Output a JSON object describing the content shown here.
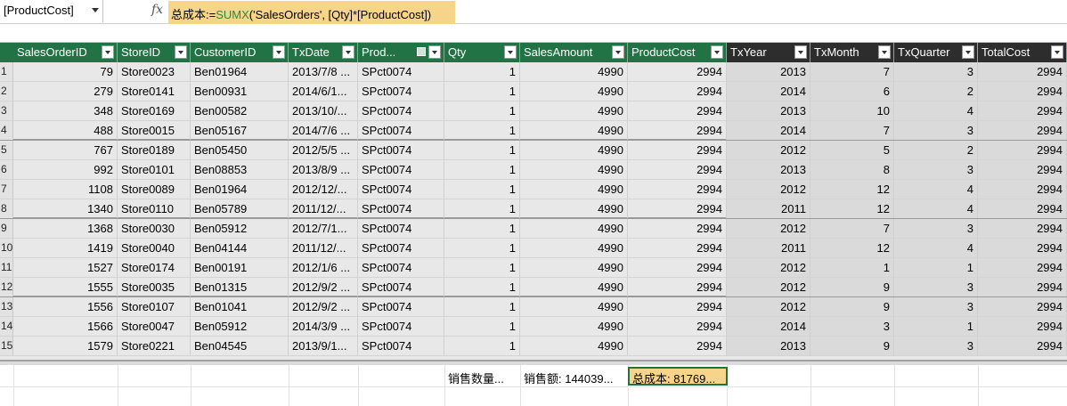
{
  "formula_bar": {
    "name_box": "[ProductCost]",
    "fx": "fx",
    "formula_prefix": "总成本:=",
    "formula_fn": "SUMX",
    "formula_rest": "('SalesOrders', [Qty]*[ProductCost])"
  },
  "columns": [
    "SalesOrderID",
    "StoreID",
    "CustomerID",
    "TxDate",
    "Prod...",
    "Qty",
    "SalesAmount",
    "ProductCost",
    "TxYear",
    "TxMonth",
    "TxQuarter",
    "TotalCost"
  ],
  "rows": [
    {
      "n": "1",
      "c": [
        "79",
        "Store0023",
        "Ben01964",
        "2013/7/8 ...",
        "SPct0074",
        "1",
        "4990",
        "2994",
        "2013",
        "7",
        "3",
        "2994"
      ]
    },
    {
      "n": "2",
      "c": [
        "279",
        "Store0141",
        "Ben00931",
        "2014/6/1...",
        "SPct0074",
        "1",
        "4990",
        "2994",
        "2014",
        "6",
        "2",
        "2994"
      ]
    },
    {
      "n": "3",
      "c": [
        "348",
        "Store0169",
        "Ben00582",
        "2013/10/...",
        "SPct0074",
        "1",
        "4990",
        "2994",
        "2013",
        "10",
        "4",
        "2994"
      ]
    },
    {
      "n": "4",
      "c": [
        "488",
        "Store0015",
        "Ben05167",
        "2014/7/6 ...",
        "SPct0074",
        "1",
        "4990",
        "2994",
        "2014",
        "7",
        "3",
        "2994"
      ]
    },
    {
      "n": "5",
      "c": [
        "767",
        "Store0189",
        "Ben05450",
        "2012/5/5 ...",
        "SPct0074",
        "1",
        "4990",
        "2994",
        "2012",
        "5",
        "2",
        "2994"
      ]
    },
    {
      "n": "6",
      "c": [
        "992",
        "Store0101",
        "Ben08853",
        "2013/8/9 ...",
        "SPct0074",
        "1",
        "4990",
        "2994",
        "2013",
        "8",
        "3",
        "2994"
      ]
    },
    {
      "n": "7",
      "c": [
        "1108",
        "Store0089",
        "Ben01964",
        "2012/12/...",
        "SPct0074",
        "1",
        "4990",
        "2994",
        "2012",
        "12",
        "4",
        "2994"
      ]
    },
    {
      "n": "8",
      "c": [
        "1340",
        "Store0110",
        "Ben05789",
        "2011/12/...",
        "SPct0074",
        "1",
        "4990",
        "2994",
        "2011",
        "12",
        "4",
        "2994"
      ]
    },
    {
      "n": "9",
      "c": [
        "1368",
        "Store0030",
        "Ben05912",
        "2012/7/1...",
        "SPct0074",
        "1",
        "4990",
        "2994",
        "2012",
        "7",
        "3",
        "2994"
      ]
    },
    {
      "n": "10",
      "c": [
        "1419",
        "Store0040",
        "Ben04144",
        "2011/12/...",
        "SPct0074",
        "1",
        "4990",
        "2994",
        "2011",
        "12",
        "4",
        "2994"
      ]
    },
    {
      "n": "11",
      "c": [
        "1527",
        "Store0174",
        "Ben00191",
        "2012/1/6 ...",
        "SPct0074",
        "1",
        "4990",
        "2994",
        "2012",
        "1",
        "1",
        "2994"
      ]
    },
    {
      "n": "12",
      "c": [
        "1555",
        "Store0035",
        "Ben01315",
        "2012/9/2 ...",
        "SPct0074",
        "1",
        "4990",
        "2994",
        "2012",
        "9",
        "3",
        "2994"
      ]
    },
    {
      "n": "13",
      "c": [
        "1556",
        "Store0107",
        "Ben01041",
        "2012/9/2 ...",
        "SPct0074",
        "1",
        "4990",
        "2994",
        "2012",
        "9",
        "3",
        "2994"
      ]
    },
    {
      "n": "14",
      "c": [
        "1566",
        "Store0047",
        "Ben05912",
        "2014/3/9 ...",
        "SPct0074",
        "1",
        "4990",
        "2994",
        "2014",
        "3",
        "1",
        "2994"
      ]
    },
    {
      "n": "15",
      "c": [
        "1579",
        "Store0221",
        "Ben04545",
        "2013/9/1...",
        "SPct0074",
        "1",
        "4990",
        "2994",
        "2013",
        "9",
        "3",
        "2994"
      ]
    }
  ],
  "measures": [
    "销售数量...",
    "销售额: 144039...",
    "总成本: 81769..."
  ],
  "colors": {
    "header_green": "#217346",
    "formula_highlight": "#f6d58a",
    "fn_green": "#2b8a3e"
  }
}
